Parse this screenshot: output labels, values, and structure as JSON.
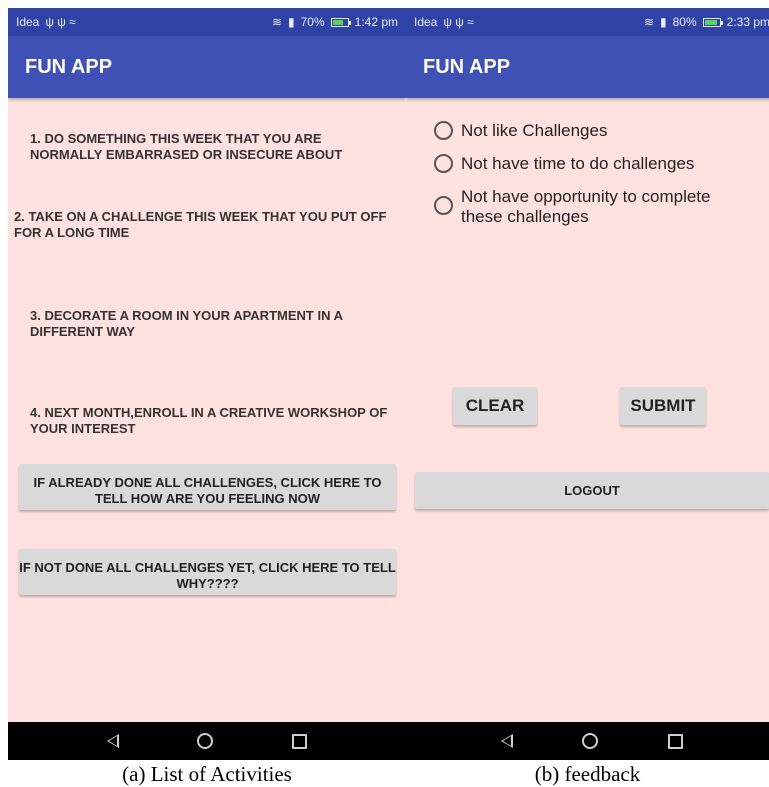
{
  "screen_a": {
    "status": {
      "carrier": "Idea",
      "signal_icons": "ψ ψ ≈",
      "battery_pct_label": "70%",
      "battery_level": 0.7,
      "time": "1:42 pm"
    },
    "appbar_title": "FUN APP",
    "activities": [
      "1. DO SOMETHING THIS WEEK THAT YOU ARE NORMALLY EMBARRASED OR INSECURE ABOUT",
      "2. TAKE ON A CHALLENGE THIS WEEK THAT YOU PUT OFF FOR A LONG TIME",
      "3. DECORATE A ROOM IN YOUR APARTMENT IN A DIFFERENT WAY",
      "4. NEXT MONTH,ENROLL IN A CREATIVE WORKSHOP OF YOUR INTEREST"
    ],
    "done_button": "IF ALREADY DONE ALL CHALLENGES,  CLICK HERE TO TELL  HOW  ARE YOU FEELING NOW",
    "not_done_button": "IF NOT DONE ALL CHALLENGES YET,  CLICK HERE TO TELL WHY????",
    "caption": "(a) List of Activities"
  },
  "screen_b": {
    "status": {
      "carrier": "Idea",
      "signal_icons": "ψ ψ ≈",
      "battery_pct_label": "80%",
      "battery_level": 0.8,
      "time": "2:33 pm"
    },
    "appbar_title": "FUN APP",
    "options": [
      "Not like Challenges",
      "Not have time to do challenges",
      "Not have opportunity to complete these challenges"
    ],
    "clear_button": "CLEAR",
    "submit_button": "SUBMIT",
    "logout_button": "LOGOUT",
    "caption": "(b) feedback"
  },
  "icons": {
    "wifi": "wifi-icon",
    "signal": "signal-icon",
    "battery": "battery-icon",
    "nav_back": "back-triangle-icon",
    "nav_home": "home-circle-icon",
    "nav_recent": "recent-square-icon"
  },
  "colors": {
    "status_bar": "#2f43a7",
    "app_bar": "#3f51b5",
    "background": "#ffe1df",
    "button": "#d9d9d9",
    "nav_bar": "#000000"
  }
}
